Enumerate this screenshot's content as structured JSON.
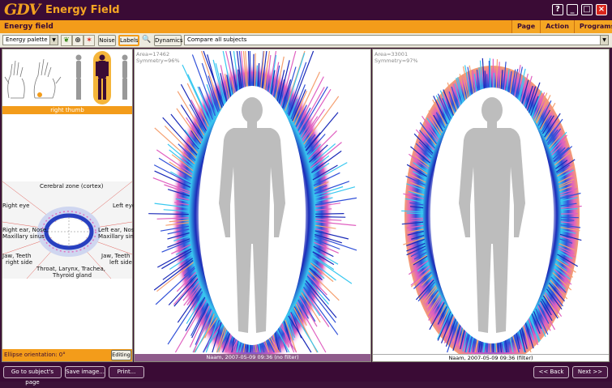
{
  "app": {
    "logo": "GDV",
    "title": "Energy Field"
  },
  "section": {
    "title": "Energy field"
  },
  "menu": [
    "Page",
    "Action",
    "Programs"
  ],
  "window_controls": {
    "help": "?",
    "minimize": "_",
    "maximize": "□",
    "close": "×"
  },
  "toolbar": {
    "palette_value": "Energy palette",
    "noise_label": "Noise",
    "labels_label": "Labels",
    "dynamics_label": "Dynamics",
    "compare_value": "Compare all subjects"
  },
  "left_panel": {
    "thumb_label": "right thumb",
    "sectors": {
      "top": "Cerebral zone (cortex)",
      "right_eye": "Right eye",
      "left_eye": "Left eye",
      "right_ear": "Right ear, Nose,",
      "right_ear2": "Maxillary sinus",
      "left_ear": "Left ear, Nose,",
      "left_ear2": "Maxillary sinus",
      "jaw_right": "Jaw, Teeth",
      "jaw_right2": "right side",
      "jaw_left": "Jaw, Teeth",
      "jaw_left2": "left side",
      "throat1": "Throat, Larynx, Trachea,",
      "throat2": "Thyroid gland"
    },
    "orientation": "Ellipse orientation: 0°",
    "edit_label": "Editing"
  },
  "panels": [
    {
      "area": "Area=17462",
      "symmetry": "Symmetry=96%",
      "caption": "Naam, 2007-05-09 09:36 (no filter)"
    },
    {
      "area": "Area=33001",
      "symmetry": "Symmetry=97%",
      "caption": "Naam, 2007-05-09 09:36 (filter)"
    }
  ],
  "bottom": {
    "go_subject": "Go to subject's page",
    "save_image": "Save image...",
    "print": "Print...",
    "back": "<< Back",
    "next": "Next >>"
  },
  "colors": {
    "brand_purple": "#3a0b35",
    "accent_orange": "#f39c1a"
  }
}
